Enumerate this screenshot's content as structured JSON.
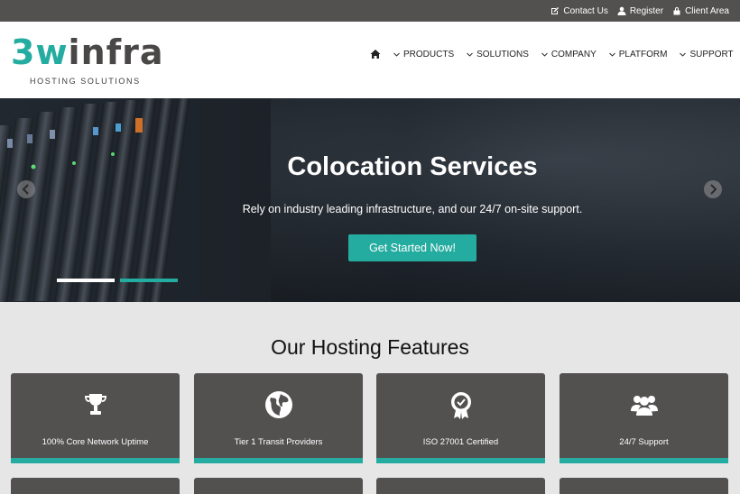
{
  "topbar": {
    "contact": "Contact Us",
    "register": "Register",
    "client_area": "Client Area"
  },
  "logo": {
    "mark_a": "3w",
    "mark_b": "infra",
    "tagline": "HOSTING SOLUTIONS"
  },
  "nav": {
    "home_icon": "home-icon",
    "items": [
      {
        "label": "PRODUCTS"
      },
      {
        "label": "SOLUTIONS"
      },
      {
        "label": "COMPANY"
      },
      {
        "label": "PLATFORM"
      },
      {
        "label": "SUPPORT"
      }
    ]
  },
  "hero": {
    "title": "Colocation Services",
    "subtitle": "Rely on industry leading infrastructure, and our 24/7 on-site support.",
    "cta": "Get Started Now!",
    "slide_count": 2,
    "active_slide": 2
  },
  "features": {
    "title": "Our Hosting Features",
    "cards": [
      {
        "label": "100% Core Network Uptime",
        "icon": "trophy-icon"
      },
      {
        "label": "Tier 1 Transit Providers",
        "icon": "globe-icon"
      },
      {
        "label": "ISO 27001 Certified",
        "icon": "award-badge-icon"
      },
      {
        "label": "24/7 Support",
        "icon": "users-icon"
      }
    ]
  },
  "colors": {
    "accent": "#25aca0",
    "dark": "#535050",
    "background": "#e6e6e6"
  }
}
